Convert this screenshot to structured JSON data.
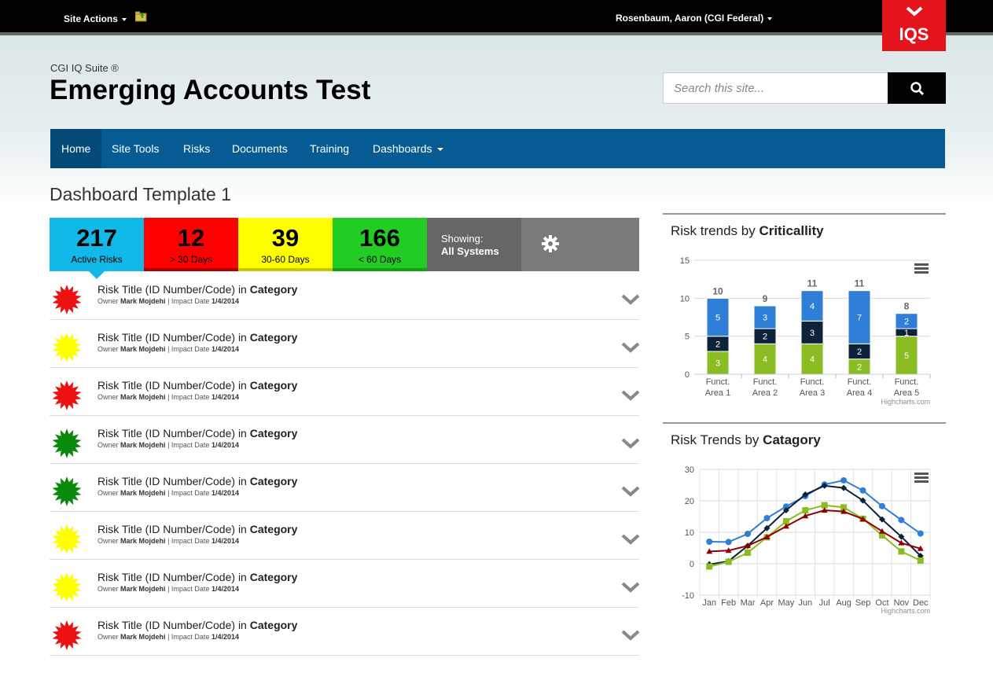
{
  "topbar": {
    "site_actions": "Site Actions",
    "user": "Rosenbaum, Aaron (CGI Federal)",
    "logo_text": "IQS",
    "folder_icon": "folder-up-icon"
  },
  "header": {
    "suite_label": "CGI IQ Suite ®",
    "site_title": "Emerging Accounts Test",
    "search_placeholder": "Search this site..."
  },
  "nav": {
    "items": [
      {
        "label": "Home"
      },
      {
        "label": "Site Tools"
      },
      {
        "label": "Risks"
      },
      {
        "label": "Documents"
      },
      {
        "label": "Training"
      },
      {
        "label": "Dashboards"
      }
    ]
  },
  "page_title": "Dashboard Template 1",
  "tiles": [
    {
      "value": "217",
      "label": "Active Risks",
      "color": "#11b8e8"
    },
    {
      "value": "12",
      "label": "> 30 Days",
      "color": "#ff0000"
    },
    {
      "value": "39",
      "label": "30-60 Days",
      "color": "#ffff00"
    },
    {
      "value": "166",
      "label": "< 60 Days",
      "color": "#22cc22"
    }
  ],
  "showing": {
    "label": "Showing:",
    "value": "All Systems"
  },
  "risks": [
    {
      "title": "Risk Title (ID Number/Code)",
      "in": "in",
      "category": "Category",
      "owner_label": "Owner",
      "owner": "Mark Mojdehi",
      "date_label": "| Impact Date",
      "date": "1/4/2014",
      "color": "#ee1111"
    },
    {
      "title": "Risk Title (ID Number/Code)",
      "in": "in",
      "category": "Category",
      "owner_label": "Owner",
      "owner": "Mark Mojdehi",
      "date_label": "| Impact Date",
      "date": "1/4/2014",
      "color": "#ffff00"
    },
    {
      "title": "Risk Title (ID Number/Code)",
      "in": "in",
      "category": "Category",
      "owner_label": "Owner",
      "owner": "Mark Mojdehi",
      "date_label": "| Impact Date",
      "date": "1/4/2014",
      "color": "#ee1111"
    },
    {
      "title": "Risk Title (ID Number/Code)",
      "in": "in",
      "category": "Category",
      "owner_label": "Owner",
      "owner": "Mark Mojdehi",
      "date_label": "| Impact Date",
      "date": "1/4/2014",
      "color": "#0a8a0a"
    },
    {
      "title": "Risk Title (ID Number/Code)",
      "in": "in",
      "category": "Category",
      "owner_label": "Owner",
      "owner": "Mark Mojdehi",
      "date_label": "| Impact Date",
      "date": "1/4/2014",
      "color": "#0a8a0a"
    },
    {
      "title": "Risk Title (ID Number/Code)",
      "in": "in",
      "category": "Category",
      "owner_label": "Owner",
      "owner": "Mark Mojdehi",
      "date_label": "| Impact Date",
      "date": "1/4/2014",
      "color": "#ffff00"
    },
    {
      "title": "Risk Title (ID Number/Code)",
      "in": "in",
      "category": "Category",
      "owner_label": "Owner",
      "owner": "Mark Mojdehi",
      "date_label": "| Impact Date",
      "date": "1/4/2014",
      "color": "#ffff00"
    },
    {
      "title": "Risk Title (ID Number/Code)",
      "in": "in",
      "category": "Category",
      "owner_label": "Owner",
      "owner": "Mark Mojdehi",
      "date_label": "| Impact Date",
      "date": "1/4/2014",
      "color": "#ee1111"
    }
  ],
  "chart_data": [
    {
      "type": "bar",
      "stacked": true,
      "title_prefix": "Risk trends by",
      "title_bold": "Criticallity",
      "categories": [
        "Funct. Area 1",
        "Funct. Area 2",
        "Funct. Area 3",
        "Funct. Area 4",
        "Funct. Area 5"
      ],
      "series": [
        {
          "values": [
            3,
            4,
            4,
            2,
            5
          ],
          "color": "#8bbc21"
        },
        {
          "values": [
            2,
            2,
            3,
            2,
            1
          ],
          "color": "#0d233a"
        },
        {
          "values": [
            5,
            3,
            4,
            7,
            2
          ],
          "color": "#2f7ed8"
        }
      ],
      "totals": [
        10,
        9,
        11,
        11,
        8
      ],
      "yticks": [
        0,
        5,
        10,
        15
      ],
      "ylim": [
        0,
        15
      ],
      "credit": "Highcharts.com"
    },
    {
      "type": "line",
      "title_prefix": "Risk Trends by",
      "title_bold": "Catagory",
      "categories": [
        "Jan",
        "Feb",
        "Mar",
        "Apr",
        "May",
        "Jun",
        "Jul",
        "Aug",
        "Sep",
        "Oct",
        "Nov",
        "Dec"
      ],
      "series": [
        {
          "values": [
            7.0,
            6.9,
            9.5,
            14.5,
            18.2,
            21.5,
            25.2,
            26.5,
            23.3,
            18.3,
            13.9,
            9.6
          ],
          "color": "#2f7ed8",
          "marker": "circle"
        },
        {
          "values": [
            -0.2,
            0.8,
            5.7,
            11.3,
            17.0,
            22.0,
            24.8,
            24.1,
            20.1,
            14.1,
            8.6,
            2.5
          ],
          "color": "#0d233a",
          "marker": "diamond"
        },
        {
          "values": [
            -0.9,
            0.6,
            3.5,
            8.4,
            13.5,
            17.0,
            18.6,
            17.9,
            14.3,
            9.0,
            3.9,
            1.0
          ],
          "color": "#8bbc21",
          "marker": "square"
        },
        {
          "values": [
            3.9,
            4.2,
            5.7,
            8.5,
            11.9,
            15.2,
            17.0,
            16.6,
            14.2,
            10.3,
            6.6,
            4.8
          ],
          "color": "#910000",
          "marker": "triangle"
        }
      ],
      "yticks": [
        -10,
        0,
        10,
        20,
        30
      ],
      "ylim": [
        -10,
        30
      ],
      "credit": "Highcharts.com"
    }
  ]
}
